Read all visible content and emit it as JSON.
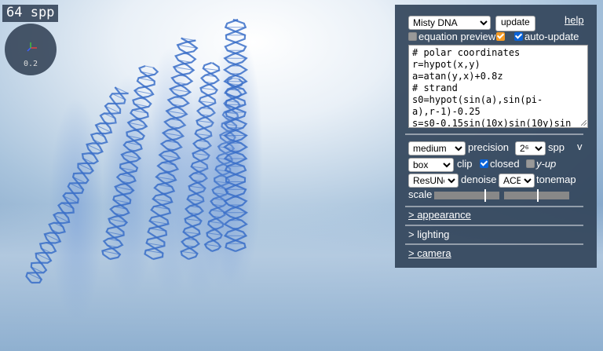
{
  "overlay": {
    "spp_label": "64 spp",
    "axes_scale": "0.2"
  },
  "panel": {
    "preset": {
      "selected": "Misty DNA"
    },
    "update_label": "update",
    "help_label": "help",
    "equation_preview": {
      "label": "equation preview",
      "checked": false
    },
    "auto_update": {
      "label": "auto-update",
      "checked": true
    },
    "code": "# polar coordinates\nr=hypot(x,y)\na=atan(y,x)+0.8z\n# strand\ns0=hypot(sin(a),sin(pi-\na),r-1)-0.25\ns=s0-0.15sin(10x)sin(10y)sin",
    "precision": {
      "selected": "medium",
      "label": "precision"
    },
    "spp_select": {
      "selected": "2⁶",
      "label": "spp"
    },
    "collapse_label": "v",
    "clip": {
      "selected": "box",
      "label": "clip"
    },
    "closed": {
      "label": "closed",
      "checked": true
    },
    "y_up": {
      "label": "y-up",
      "checked": false
    },
    "denoise": {
      "selected": "ResUNet",
      "label": "denoise"
    },
    "tonemap": {
      "selected": "ACES",
      "label": "tonemap"
    },
    "scale": {
      "label": "scale",
      "slider1": 0.77,
      "slider2": 0.5
    },
    "sections": [
      "> appearance",
      "> lighting",
      "> camera"
    ]
  },
  "colors": {
    "panel_bg": "#32445a",
    "checkbox_blue": "#0a63d8",
    "checkbox_orange": "#f59a23",
    "dna_blue": "#3a6ec8"
  }
}
